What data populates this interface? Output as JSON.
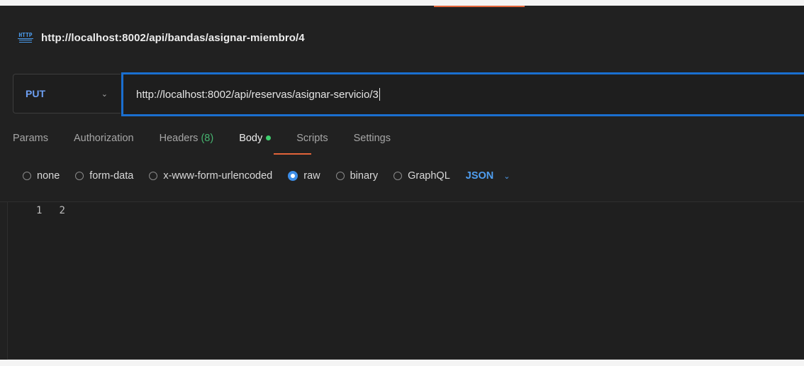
{
  "request": {
    "title": "http://localhost:8002/api/bandas/asignar-miembro/4",
    "method": "PUT",
    "url": "http://localhost:8002/api/reservas/asignar-servicio/3"
  },
  "tabs": {
    "params": "Params",
    "authorization": "Authorization",
    "headers": "Headers",
    "headers_count": "(8)",
    "body": "Body",
    "scripts": "Scripts",
    "settings": "Settings",
    "active": "Body"
  },
  "body_types": {
    "options": [
      "none",
      "form-data",
      "x-www-form-urlencoded",
      "raw",
      "binary",
      "GraphQL"
    ],
    "selected": "raw",
    "format": "JSON"
  },
  "editor": {
    "line_numbers": [
      "1",
      "2"
    ]
  },
  "colors": {
    "accent_orange": "#e2643a",
    "focus_blue": "#1a6fd0",
    "method_blue": "#6d9ff2",
    "body_dot_green": "#3ecf6e"
  },
  "icons": {
    "http": "http-icon",
    "method_chevron": "chevron-down-icon",
    "json_chevron": "chevron-down-icon"
  }
}
